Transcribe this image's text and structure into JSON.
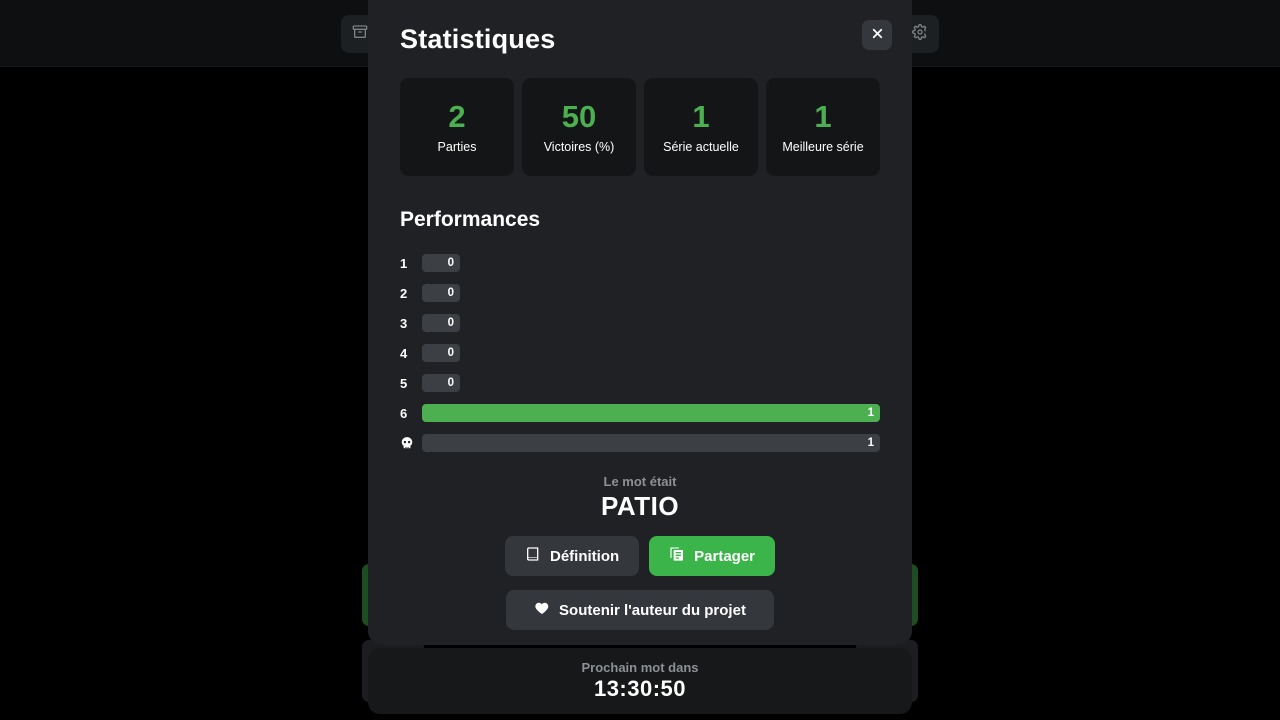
{
  "background": {
    "archive_icon": "archive-icon",
    "gear_icon": "gear-icon"
  },
  "modal": {
    "title": "Statistiques",
    "close_label": "✕",
    "stats": [
      {
        "value": "2",
        "label": "Parties"
      },
      {
        "value": "50",
        "label": "Victoires (%)"
      },
      {
        "value": "1",
        "label": "Série actuelle"
      },
      {
        "value": "1",
        "label": "Meilleure série"
      }
    ],
    "performances": {
      "title": "Performances",
      "rows": [
        {
          "key": "1",
          "count": "0",
          "filled": false
        },
        {
          "key": "2",
          "count": "0",
          "filled": false
        },
        {
          "key": "3",
          "count": "0",
          "filled": false
        },
        {
          "key": "4",
          "count": "0",
          "filled": false
        },
        {
          "key": "5",
          "count": "0",
          "filled": false
        },
        {
          "key": "6",
          "count": "1",
          "filled": true
        },
        {
          "key": "☠",
          "count": "1",
          "filled": false
        }
      ]
    },
    "word_reveal": {
      "prefix": "Le mot était",
      "word": "PATIO"
    },
    "actions": {
      "definition": "Définition",
      "share": "Partager",
      "support": "Soutenir l'auteur du projet"
    }
  },
  "countdown": {
    "label": "Prochain mot dans",
    "value": "13:30:50"
  },
  "colors": {
    "accent_green": "#4caf50",
    "share_green": "#3bb54a",
    "modal_bg": "#1f2124",
    "card_bg": "#131517",
    "bar_empty": "#3c4044",
    "muted_text": "#8d9094"
  },
  "chart_data": {
    "type": "bar",
    "title": "Performances",
    "categories": [
      "1",
      "2",
      "3",
      "4",
      "5",
      "6",
      "skull"
    ],
    "values": [
      0,
      0,
      0,
      0,
      0,
      1,
      1
    ],
    "xlabel": "",
    "ylabel": "",
    "orientation": "horizontal",
    "highlight_category": "6",
    "ylim": [
      0,
      1
    ]
  }
}
